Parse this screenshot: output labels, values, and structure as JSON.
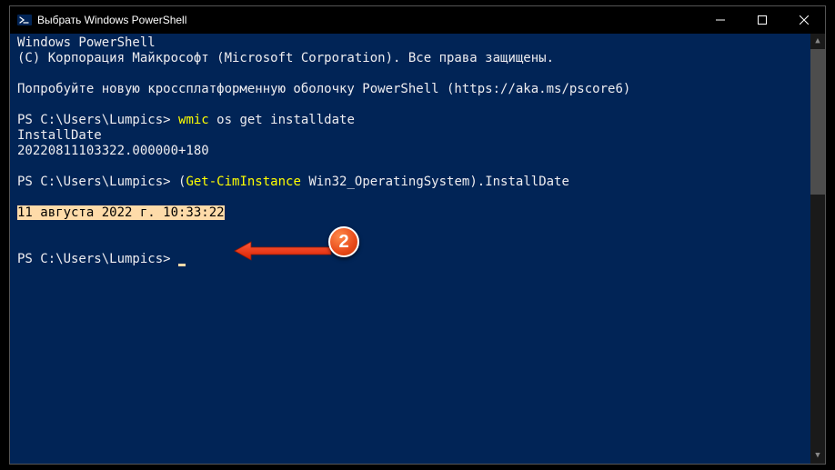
{
  "titlebar": {
    "title": "Выбрать Windows PowerShell"
  },
  "terminal": {
    "header1": "Windows PowerShell",
    "header2": "(C) Корпорация Майкрософт (Microsoft Corporation). Все права защищены.",
    "tryMsg": "Попробуйте новую кроссплатформенную оболочку PowerShell (https://aka.ms/pscore6)",
    "prompt1": "PS C:\\Users\\Lumpics> ",
    "cmd1": "wmic",
    "cmd1rest": " os get installdate",
    "result1a": "InstallDate",
    "result1b": "20220811103322.000000+180",
    "prompt2": "PS C:\\Users\\Lumpics> ",
    "cmd2paren": "(",
    "cmd2yellow": "Get-CimInstance",
    "cmd2rest": " Win32_OperatingSystem",
    "cmd2paren2": ")",
    "cmd2dot": ".InstallDate",
    "highlightDate": "11 августа 2022 г. 10:33:22",
    "prompt3": "PS C:\\Users\\Lumpics> "
  },
  "badge": {
    "number": "2"
  }
}
